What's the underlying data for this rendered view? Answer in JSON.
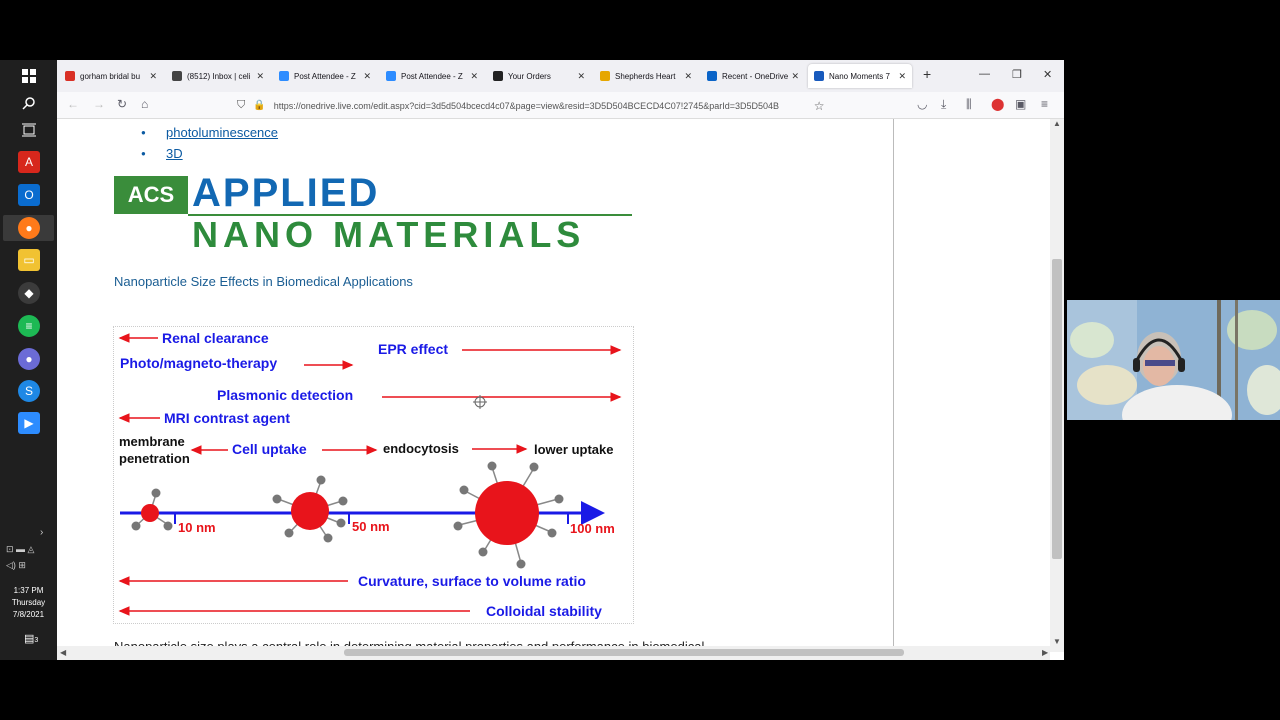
{
  "taskbar": {
    "time": "1:37 PM",
    "day": "Thursday",
    "date": "7/8/2021",
    "icons": [
      "windows-start-icon",
      "search-icon",
      "task-view-icon",
      "acrobat-icon",
      "outlook-icon",
      "firefox-icon",
      "file-explorer-icon",
      "app-icon",
      "spotify-icon",
      "app-icon-2",
      "skype-icon",
      "zoom-icon"
    ],
    "notification_badge": "3"
  },
  "browser": {
    "tabs": [
      {
        "label": "gorham bridal bu",
        "color": "#d93025"
      },
      {
        "label": "(8512) Inbox | celi",
        "color": "#444444"
      },
      {
        "label": "Post Attendee - Z",
        "color": "#2d8cff"
      },
      {
        "label": "Post Attendee - Z",
        "color": "#2d8cff"
      },
      {
        "label": "Your Orders",
        "color": "#222222"
      },
      {
        "label": "Shepherds Heart",
        "color": "#e6a700"
      },
      {
        "label": "Recent - OneDrive",
        "color": "#0a64c8"
      },
      {
        "label": "Nano Moments 7",
        "color": "#185abd"
      }
    ],
    "url": "https://onedrive.live.com/edit.aspx?cid=3d5d504bcecd4c07&page=view&resid=3D5D504BCECD4C07!2745&parId=3D5D504B"
  },
  "document": {
    "bullets": [
      "photoluminescence",
      "3D"
    ],
    "logo": {
      "acs": "ACS",
      "line1": "APPLIED",
      "line2": "NANO MATERIALS"
    },
    "subtitle": "Nanoparticle Size Effects in Biomedical Applications",
    "figure": {
      "renal": "Renal clearance",
      "photo": "Photo/magneto-therapy",
      "epr": "EPR effect",
      "plasmonic": "Plasmonic detection",
      "mri": "MRI contrast agent",
      "membrane1": "membrane",
      "membrane2": "penetration",
      "cell_uptake": "Cell uptake",
      "endocytosis": "endocytosis",
      "lower_uptake": "lower uptake",
      "size1": "10 nm",
      "size2": "50 nm",
      "size3": "100 nm",
      "curvature": "Curvature, surface to volume ratio",
      "colloidal": "Colloidal stability",
      "color_red": "#e8141b",
      "color_blue": "#1a1ae6"
    },
    "cut_text": "Nanoparticle size plays a central role in determining material properties and performance in biomedical"
  }
}
